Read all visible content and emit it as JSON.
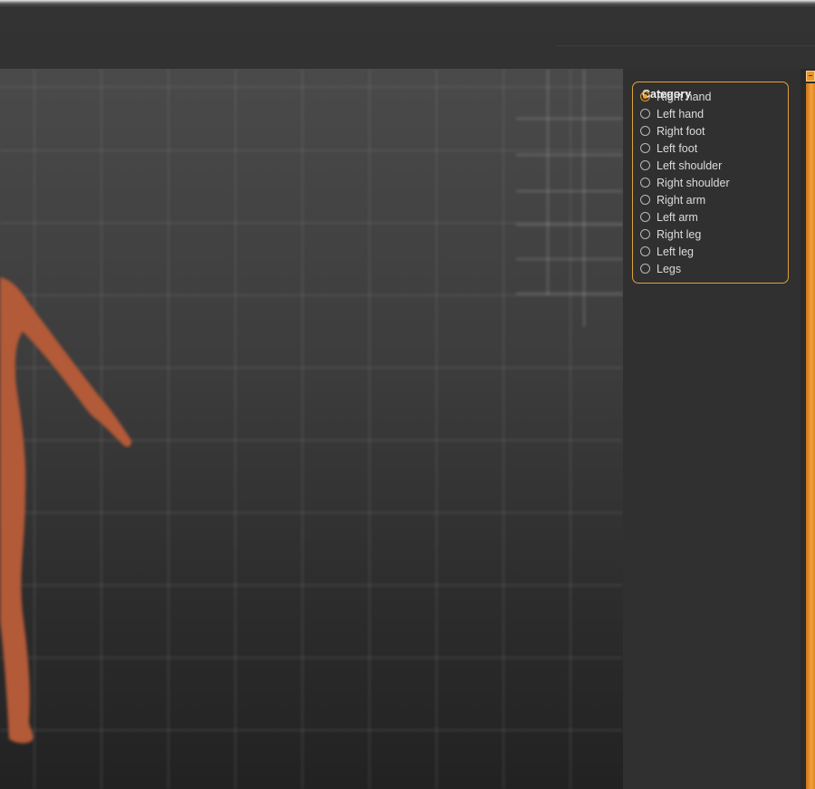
{
  "category": {
    "legend": "Category",
    "options": [
      {
        "label": "Right hand",
        "selected": true
      },
      {
        "label": "Left hand",
        "selected": false
      },
      {
        "label": "Right foot",
        "selected": false
      },
      {
        "label": "Left foot",
        "selected": false
      },
      {
        "label": "Left shoulder",
        "selected": false
      },
      {
        "label": "Right shoulder",
        "selected": false
      },
      {
        "label": "Right arm",
        "selected": false
      },
      {
        "label": "Left arm",
        "selected": false
      },
      {
        "label": "Right leg",
        "selected": false
      },
      {
        "label": "Left leg",
        "selected": false
      },
      {
        "label": "Legs",
        "selected": false
      }
    ]
  },
  "colors": {
    "accent": "#e79a2a",
    "panel_bg": "#303030",
    "figure": "#b35a38"
  }
}
